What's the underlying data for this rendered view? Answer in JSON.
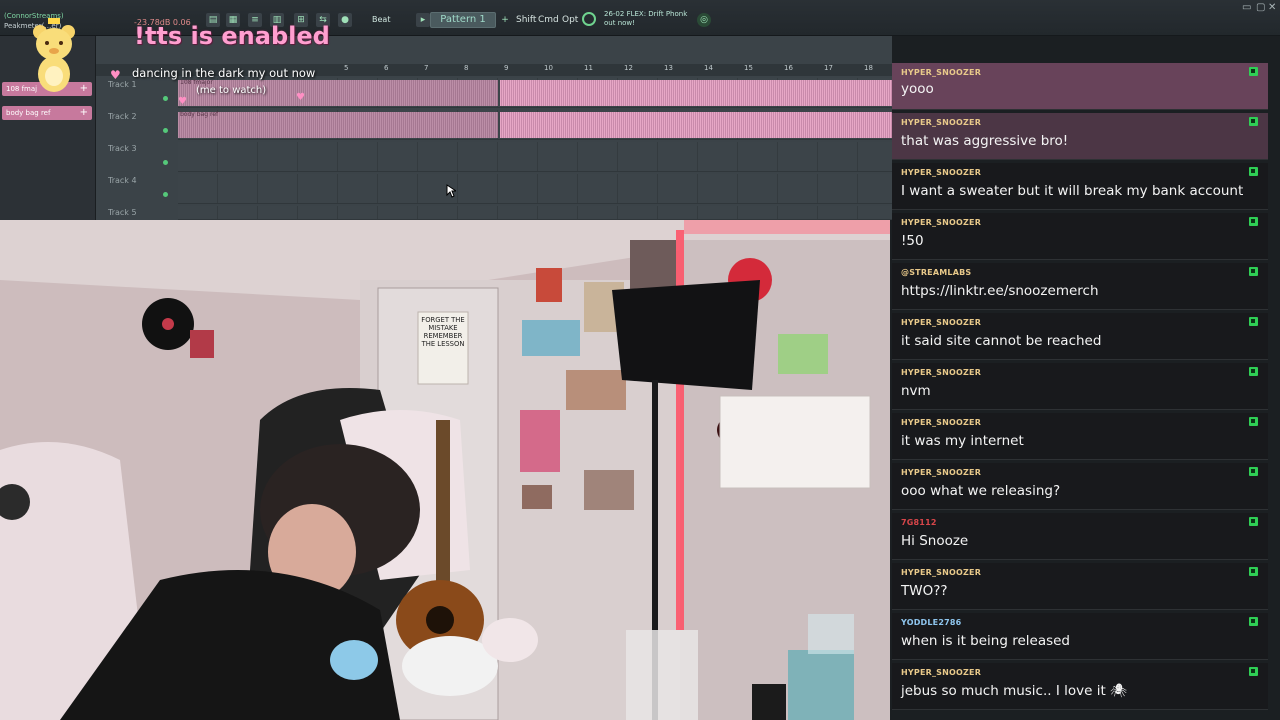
{
  "daw": {
    "meter_text": "-23.78dB 0.06",
    "beat_label": "Beat",
    "pattern_label": "Pattern 1",
    "pattern_add": "+",
    "modifiers": [
      "Shift",
      "Cmd",
      "Opt"
    ],
    "news_line1": "26-02 FLEX: Drift Phonk",
    "news_line2": "out now!",
    "window_controls": [
      "▭",
      "▢",
      "✕"
    ],
    "sidebar_label_top": "(ConnorStreams)",
    "sidebar_label_mid": "Peakmeter(…er)",
    "channels": [
      {
        "label": "108 fmaj"
      },
      {
        "label": "body bag ref"
      }
    ],
    "ruler_numbers": [
      "5",
      "6",
      "7",
      "8",
      "9",
      "10",
      "11",
      "12",
      "13",
      "14",
      "15",
      "16",
      "17",
      "18"
    ],
    "tracks": [
      {
        "name": "Track 1",
        "clip": "108 fmajor"
      },
      {
        "name": "Track 2",
        "clip": "body bag ref"
      },
      {
        "name": "Track 3",
        "clip": ""
      },
      {
        "name": "Track 4",
        "clip": ""
      },
      {
        "name": "Track 5",
        "clip": ""
      }
    ]
  },
  "overlay": {
    "tts_notice": "!tts is enabled",
    "now_playing": "dancing in the dark my out now",
    "now_playing_sub": "(me to watch)"
  },
  "webcam": {
    "poster_text": "FORGET THE MISTAKE REMEMBER THE LESSON"
  },
  "chat": {
    "messages": [
      {
        "user": "HYPER_SNOOZER",
        "text": "yooo",
        "user_color": "gold"
      },
      {
        "user": "HYPER_SNOOZER",
        "text": "that was aggressive bro!",
        "user_color": "gold"
      },
      {
        "user": "HYPER_SNOOZER",
        "text": "I want a sweater but it will break my bank account",
        "user_color": "gold"
      },
      {
        "user": "HYPER_SNOOZER",
        "text": "!50",
        "user_color": "gold"
      },
      {
        "user": "@STREAMLABS",
        "text": "https://linktr.ee/snoozemerch",
        "user_color": "gold"
      },
      {
        "user": "HYPER_SNOOZER",
        "text": "it said site cannot be reached",
        "user_color": "gold"
      },
      {
        "user": "HYPER_SNOOZER",
        "text": "nvm",
        "user_color": "gold"
      },
      {
        "user": "HYPER_SNOOZER",
        "text": "it was my internet",
        "user_color": "gold"
      },
      {
        "user": "HYPER_SNOOZER",
        "text": "ooo what we releasing?",
        "user_color": "gold"
      },
      {
        "user": "7G8112",
        "text": "Hi Snooze",
        "user_color": "red"
      },
      {
        "user": "HYPER_SNOOZER",
        "text": "TWO??",
        "user_color": "gold"
      },
      {
        "user": "YODDLE2786",
        "text": "when is it being released",
        "user_color": "blue"
      },
      {
        "user": "HYPER_SNOOZER",
        "text": "jebus so much music.. I love it 🕷",
        "user_color": "gold"
      }
    ]
  }
}
